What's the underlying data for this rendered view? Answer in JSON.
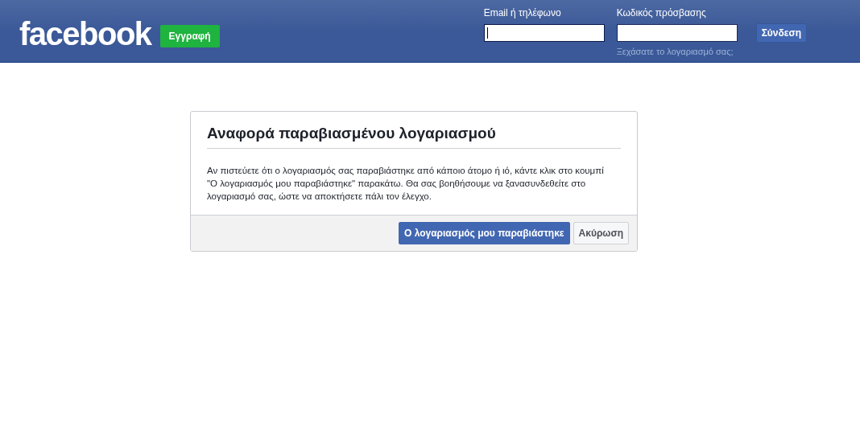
{
  "header": {
    "logo": "facebook",
    "signup_button": "Εγγραφή",
    "login": {
      "fields": [
        {
          "label": "Email ή τηλέφωνο",
          "focused": true
        },
        {
          "label": "Κωδικός πρόσβασης",
          "focused": false
        }
      ],
      "login_button": "Σύνδεση",
      "forgot_link": "Ξεχάσατε το λογαριασμό σας;"
    }
  },
  "dialog": {
    "title": "Αναφορά παραβιασμένου λογαριασμού",
    "body": "Αν πιστεύετε ότι ο λογαριασμός σας παραβιάστηκε από κάποιο άτομο ή ιό, κάντε κλικ στο κουμπί \"Ο λογαριασμός μου παραβιάστηκε\" παρακάτω. Θα σας βοηθήσουμε να ξανασυνδεθείτε στο λογαριασμό σας, ώστε να αποκτήσετε πάλι τον έλεγχο.",
    "buttons": [
      {
        "label": "Ο λογαριασμός μου παραβιάστηκε",
        "kind": "primary"
      },
      {
        "label": "Ακύρωση",
        "kind": "secondary"
      }
    ]
  }
}
